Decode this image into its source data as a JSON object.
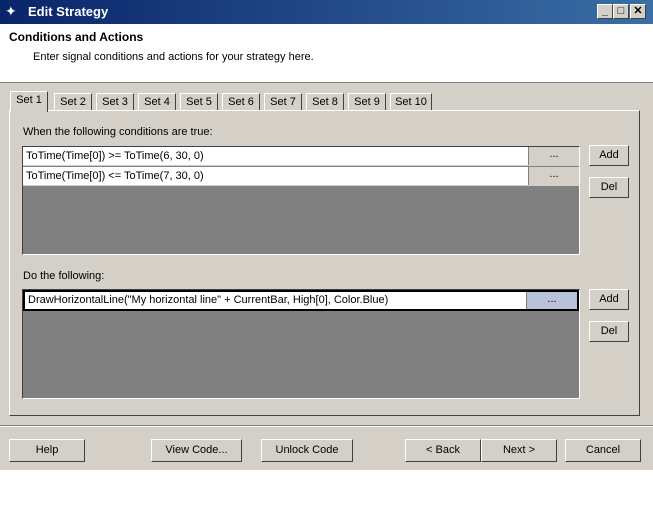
{
  "window": {
    "title": "Edit Strategy"
  },
  "header": {
    "title": "Conditions and Actions",
    "subtitle": "Enter signal conditions and actions for your strategy here."
  },
  "tabs": [
    "Set 1",
    "Set 2",
    "Set 3",
    "Set 4",
    "Set 5",
    "Set 6",
    "Set 7",
    "Set 8",
    "Set 9",
    "Set 10"
  ],
  "conditions": {
    "label": "When the following conditions are true:",
    "rows": [
      "ToTime(Time[0]) >= ToTime(6, 30, 0)",
      "ToTime(Time[0]) <= ToTime(7, 30, 0)"
    ],
    "ellipsis": "...",
    "add_label": "Add",
    "del_label": "Del"
  },
  "actions": {
    "label": "Do the following:",
    "rows": [
      "DrawHorizontalLine(\"My  horizontal  line\"  +  CurrentBar,  High[0],  Color.Blue)"
    ],
    "ellipsis": "...",
    "add_label": "Add",
    "del_label": "Del"
  },
  "footer": {
    "help": "Help",
    "view_code": "View Code...",
    "unlock_code": "Unlock Code",
    "back": "< Back",
    "next": "Next >",
    "cancel": "Cancel"
  }
}
